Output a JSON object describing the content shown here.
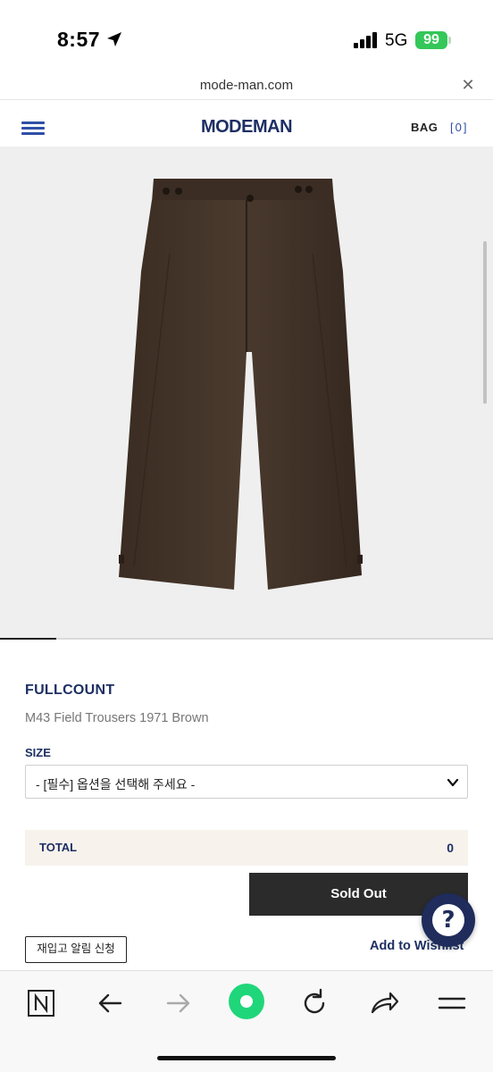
{
  "status_bar": {
    "time": "8:57",
    "network": "5G",
    "battery": "99"
  },
  "url_bar": {
    "domain": "mode-man.com",
    "close_icon": "close-icon"
  },
  "site_header": {
    "logo": "MODEMAN",
    "bag_label": "BAG",
    "bag_count": "[0]",
    "accent_color": "#2f4fa8",
    "brand_color": "#1d2f63"
  },
  "gallery": {
    "image": "brown-field-trousers",
    "progress": 0.115
  },
  "product": {
    "brand": "FULLCOUNT",
    "name": "M43 Field Trousers 1971 Brown",
    "size_label": "SIZE",
    "size_placeholder": "- [필수] 옵션을 선택해 주세요 -",
    "total_label": "TOTAL",
    "total_value": "0",
    "soldout_label": "Sold Out",
    "restock_label": "재입고 알림 신청",
    "wishlist_label": "Add to Wishlist",
    "help_icon": "?"
  },
  "browser_toolbar": {
    "icons": [
      "naver-n-icon",
      "back-arrow-icon",
      "forward-arrow-icon",
      "green-home-dot-icon",
      "reload-icon",
      "share-icon",
      "menu-lines-icon"
    ]
  }
}
